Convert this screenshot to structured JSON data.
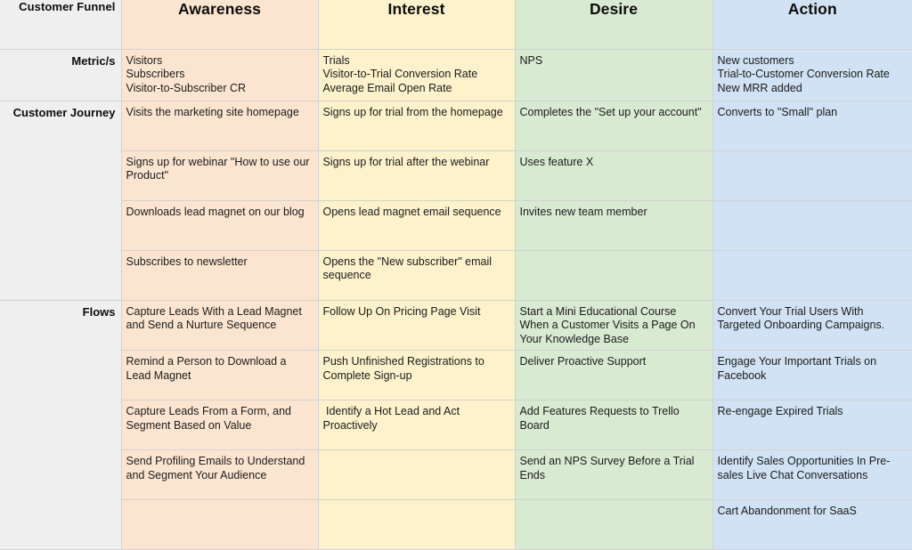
{
  "table": {
    "columns": [
      {
        "key": "label",
        "label": "Customer Funnel"
      },
      {
        "key": "awareness",
        "label": "Awareness",
        "color": "#fce5d0"
      },
      {
        "key": "interest",
        "label": "Interest",
        "color": "#fdf2cc"
      },
      {
        "key": "desire",
        "label": "Desire",
        "color": "#d9ead3"
      },
      {
        "key": "action",
        "label": "Action",
        "color": "#d0e2f3"
      }
    ],
    "sections": [
      {
        "label": "Metric/s",
        "rows": [
          {
            "awareness": "Visitors\nSubscribers\nVisitor-to-Subscriber CR",
            "interest": "Trials\nVisitor-to-Trial Conversion Rate\nAverage Email Open Rate",
            "desire": "NPS",
            "action": "New customers\nTrial-to-Customer Conversion Rate\nNew MRR added"
          }
        ]
      },
      {
        "label": "Customer Journey",
        "rows": [
          {
            "awareness": "Visits the marketing site homepage",
            "interest": "Signs up for trial from the homepage",
            "desire": "Completes the \"Set up your account\"",
            "action": "Converts to \"Small\" plan"
          },
          {
            "awareness": "Signs up for webinar \"How to use our Product\"",
            "interest": "Signs up for trial after the webinar",
            "desire": "Uses feature X",
            "action": ""
          },
          {
            "awareness": "Downloads lead magnet on our blog",
            "interest": "Opens lead magnet email sequence",
            "desire": "Invites new team member",
            "action": ""
          },
          {
            "awareness": "Subscribes to newsletter",
            "interest": "Opens the \"New subscriber\" email sequence",
            "desire": "",
            "action": ""
          }
        ]
      },
      {
        "label": "Flows",
        "rows": [
          {
            "awareness": "Capture Leads With a Lead Magnet and Send a Nurture Sequence",
            "interest": "Follow Up On Pricing Page Visit",
            "desire": "Start a Mini Educational Course When a Customer Visits a Page On Your Knowledge Base",
            "action": "Convert Your Trial Users With Targeted Onboarding Campaigns."
          },
          {
            "awareness": "Remind a Person to Download a Lead Magnet",
            "interest": "Push Unfinished Registrations to Complete Sign-up",
            "desire": "Deliver Proactive Support",
            "action": "Engage Your Important Trials on Facebook"
          },
          {
            "awareness": "Capture Leads From a Form, and Segment Based on Value",
            "interest": " Identify a Hot Lead and Act Proactively",
            "desire": "Add Features Requests to Trello Board",
            "action": "Re-engage Expired Trials"
          },
          {
            "awareness": "Send Profiling Emails to Understand and Segment Your Audience",
            "interest": "",
            "desire": "Send an NPS Survey Before a Trial Ends",
            "action": "Identify Sales Opportunities In Pre-sales Live Chat Conversations"
          },
          {
            "awareness": "",
            "interest": "",
            "desire": "",
            "action": "Cart Abandonment for SaaS"
          }
        ]
      }
    ]
  }
}
